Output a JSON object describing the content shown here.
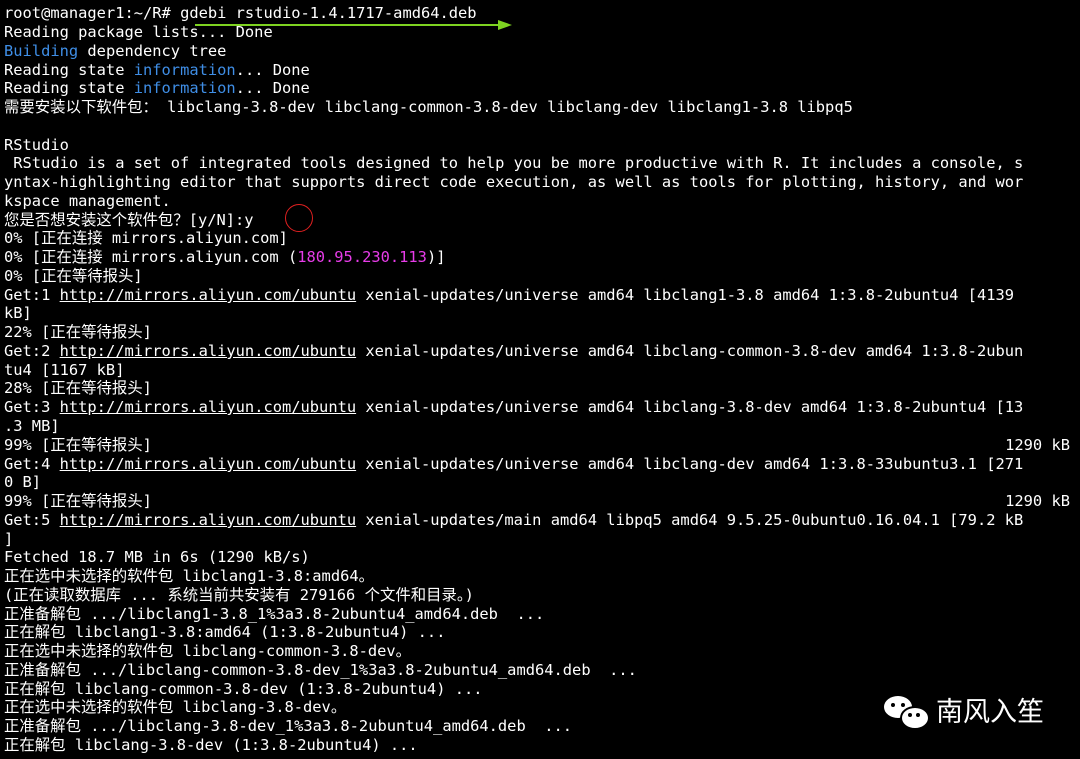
{
  "terminal": {
    "prompt": "root@manager1:~/R#",
    "command": " gdebi rstudio-1.4.1717-amd64.deb",
    "lines": {
      "l1": "Reading package lists... Done",
      "l2a": "Building",
      "l2b": " dependency tree",
      "l3a": "Reading state ",
      "l3b": "information",
      "l3c": "... Done",
      "l4a": "Reading state ",
      "l4b": "information",
      "l4c": "... Done",
      "l5": "需要安装以下软件包： libclang-3.8-dev libclang-common-3.8-dev libclang-dev libclang1-3.8 libpq5",
      "l6": "",
      "l7": "RStudio",
      "l8": " RStudio is a set of integrated tools designed to help you be more productive with R. It includes a console, s",
      "l9": "yntax-highlighting editor that supports direct code execution, as well as tools for plotting, history, and wor",
      "l10": "kspace management.",
      "l11": "您是否想安装这个软件包？[y/N]:y",
      "l12": "0% [正在连接 mirrors.aliyun.com]",
      "l13a": "0% [正在连接 mirrors.aliyun.com (",
      "l13b": "180.95.230.113",
      "l13c": ")]",
      "l14": "0% [正在等待报头]",
      "l15a": "Get:1 ",
      "l15b": "http://mirrors.aliyun.com/ubuntu",
      "l15c": " xenial-updates/universe amd64 libclang1-3.8 amd64 1:3.8-2ubuntu4 [4139",
      "l16": "kB]",
      "l17": "22% [正在等待报头]",
      "l18a": "Get:2 ",
      "l18b": "http://mirrors.aliyun.com/ubuntu",
      "l18c": " xenial-updates/universe amd64 libclang-common-3.8-dev amd64 1:3.8-2ubun",
      "l19": "tu4 [1167 kB]",
      "l20": "28% [正在等待报头]",
      "l21a": "Get:3 ",
      "l21b": "http://mirrors.aliyun.com/ubuntu",
      "l21c": " xenial-updates/universe amd64 libclang-3.8-dev amd64 1:3.8-2ubuntu4 [13",
      "l22": ".3 MB]",
      "l23": "99% [正在等待报头]",
      "l23r": "1290 kB",
      "l24a": "Get:4 ",
      "l24b": "http://mirrors.aliyun.com/ubuntu",
      "l24c": " xenial-updates/universe amd64 libclang-dev amd64 1:3.8-33ubuntu3.1 [271",
      "l25": "0 B]",
      "l26": "99% [正在等待报头]",
      "l26r": "1290 kB",
      "l27a": "Get:5 ",
      "l27b": "http://mirrors.aliyun.com/ubuntu",
      "l27c": " xenial-updates/main amd64 libpq5 amd64 9.5.25-0ubuntu0.16.04.1 [79.2 kB",
      "l28": "]",
      "l29": "Fetched 18.7 MB in 6s (1290 kB/s)",
      "l30": "正在选中未选择的软件包 libclang1-3.8:amd64。",
      "l31": "(正在读取数据库 ... 系统当前共安装有 279166 个文件和目录。)",
      "l32": "正准备解包 .../libclang1-3.8_1%3a3.8-2ubuntu4_amd64.deb  ...",
      "l33": "正在解包 libclang1-3.8:amd64 (1:3.8-2ubuntu4) ...",
      "l34": "正在选中未选择的软件包 libclang-common-3.8-dev。",
      "l35": "正准备解包 .../libclang-common-3.8-dev_1%3a3.8-2ubuntu4_amd64.deb  ...",
      "l36": "正在解包 libclang-common-3.8-dev (1:3.8-2ubuntu4) ...",
      "l37": "正在选中未选择的软件包 libclang-3.8-dev。",
      "l38": "正准备解包 .../libclang-3.8-dev_1%3a3.8-2ubuntu4_amd64.deb  ...",
      "l39": "正在解包 libclang-3.8-dev (1:3.8-2ubuntu4) ..."
    }
  },
  "watermark": {
    "text": "南风入笙",
    "icon": "wechat-icon"
  },
  "colors": {
    "background": "#000000",
    "text": "#ffffff",
    "keyword_blue": "#3f8ee6",
    "ip_magenta": "#e73ce8",
    "annotation_arrow": "#7ed321",
    "annotation_circle": "#e02020"
  }
}
